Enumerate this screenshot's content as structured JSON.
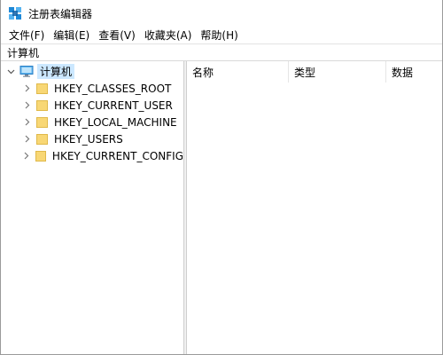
{
  "window": {
    "title": "注册表编辑器"
  },
  "menu": [
    {
      "label": "文件(F)"
    },
    {
      "label": "编辑(E)"
    },
    {
      "label": "查看(V)"
    },
    {
      "label": "收藏夹(A)"
    },
    {
      "label": "帮助(H)"
    }
  ],
  "address": {
    "path": "计算机"
  },
  "tree": {
    "root": {
      "label": "计算机",
      "expanded": true,
      "selected": true
    },
    "children": [
      {
        "label": "HKEY_CLASSES_ROOT"
      },
      {
        "label": "HKEY_CURRENT_USER"
      },
      {
        "label": "HKEY_LOCAL_MACHINE"
      },
      {
        "label": "HKEY_USERS"
      },
      {
        "label": "HKEY_CURRENT_CONFIG"
      }
    ]
  },
  "list": {
    "columns": [
      {
        "label": "名称"
      },
      {
        "label": "类型"
      },
      {
        "label": "数据"
      }
    ]
  },
  "colors": {
    "selection": "#cce8ff",
    "folder": "#f8d775",
    "folder_border": "#e0b94a",
    "icon_blue": "#1e88d6"
  },
  "icons": {
    "app": "registry-editor-icon",
    "root": "computer-icon",
    "key": "folder-icon",
    "expanded": "chevron-down-icon",
    "collapsed": "chevron-right-icon"
  }
}
